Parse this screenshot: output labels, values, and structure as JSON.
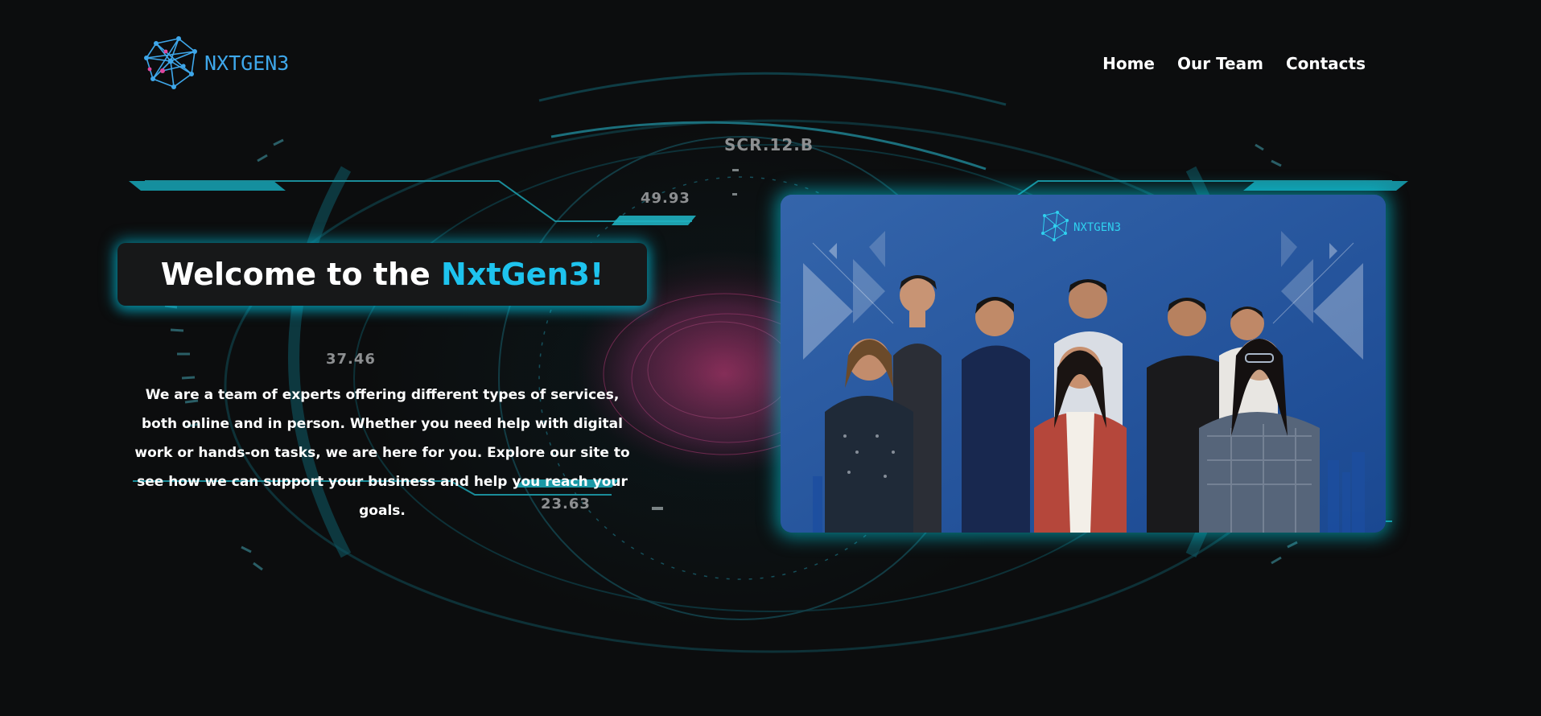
{
  "header": {
    "logo_text": "NXTGEN3",
    "logo_icon": "network-cube-icon",
    "nav": [
      {
        "label": "Home"
      },
      {
        "label": "Our Team"
      },
      {
        "label": "Contacts"
      }
    ]
  },
  "hud": {
    "label_scr": "SCR.12.B",
    "value_1": "49.93",
    "value_2": "37.46",
    "value_3": "23.63"
  },
  "hero": {
    "title_prefix": "Welcome to the ",
    "title_accent": "NxtGen3!",
    "description": "We are a team of experts offering different types of services, both online and in person. Whether you need help with digital work or hands-on tasks, we are here for you. Explore our site to see how we can support your business and help you reach your goals."
  },
  "photo": {
    "logo_text": "NXTGEN3"
  },
  "colors": {
    "accent": "#1ec3ee",
    "logo_blue": "#3ea7ea",
    "background": "#0c0d0e",
    "glow": "#00c8e6"
  }
}
